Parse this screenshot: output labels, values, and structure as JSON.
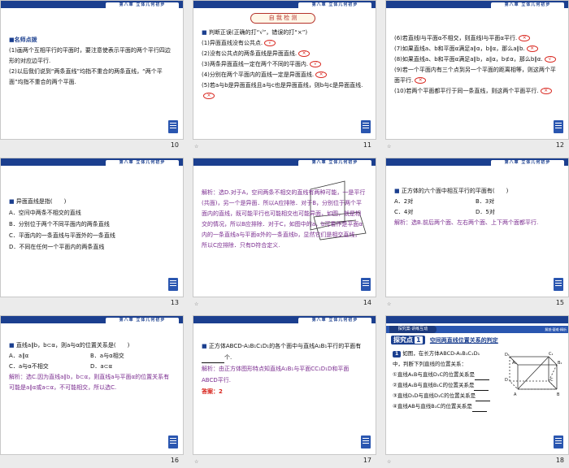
{
  "common": {
    "chapter_tab": "第八章 立体几何初步",
    "star": "☆"
  },
  "s10": {
    "num": "10",
    "heading": "■名师点拨",
    "p1": "(1)画两个互相平行的平面时，要注意使表示平面的两个平行四边形的对应边平行.",
    "p2": "(2)以后我们说到“两条直线”均指不重合的两条直线，“两个平面”均指不重合的两个平面."
  },
  "s11": {
    "num": "11",
    "title": "自 我 检 测",
    "intro": "判断正误(正确的打“√”，错误的打“×”)",
    "items": [
      {
        "text": "(1)异面直线没有公共点.",
        "mark": "√"
      },
      {
        "text": "(2)没有公共点的两条直线是异面直线.",
        "mark": "×"
      },
      {
        "text": "(3)两条异面直线一定在两个不同的平面内.",
        "mark": "√"
      },
      {
        "text": "(4)分别在两个平面内的直线一定是异面直线.",
        "mark": "×"
      },
      {
        "text": "(5)若a与b是异面直线且a与c也是异面直线，则b与c是异面直线.",
        "mark": "×"
      }
    ]
  },
  "s12": {
    "num": "12",
    "items": [
      {
        "text": "(6)若直线l与平面α不相交，则直线l与平面α平行.",
        "mark": "×"
      },
      {
        "text": "(7)如果直线a、b和平面α满足a∥α，b∥α，那么a∥b.",
        "mark": "×"
      },
      {
        "text": "(8)如果直线a、b和平面α满足a∥b，a∥α，b⊄α，那么b∥α.",
        "mark": "√"
      },
      {
        "text": "(9)若一个平面内有三个点到另一个平面的距离相等，则这两个平面平行.",
        "mark": "×"
      },
      {
        "text": "(10)若两个平面都平行于同一条直线，则这两个平面平行.",
        "mark": "×"
      }
    ]
  },
  "s13": {
    "num": "13",
    "question": "异面直线是指(　　)",
    "options": [
      "A．空间中两条不相交的直线",
      "B．分别位于两个不同平面内的两条直线",
      "C．平面内的一条直线与平面外的一条直线",
      "D．不同在任何一个平面内的两条直线"
    ]
  },
  "s14": {
    "num": "14",
    "text": "解析：选D.对于A，空间两条不相交的直线有两种可能，一是平行(共面)，另一个是异面．所以A应排除．对于B，分别位于两个平面内的直线，既可能平行也可能相交也可能异面，如图，就是相交的情况，所以B应排除．对于C，如图中的a，b可看作是平面α内的一条直线a与平面α外的一条直线b，显然它们是相交直线，所以C应排除．只有D符合定义."
  },
  "s15": {
    "num": "15",
    "question": "正方体的六个面中相互平行的平面有(　　)",
    "options": [
      "A．2对",
      "B．3对",
      "C．4对",
      "D．5对"
    ],
    "analysis": "解析：选B.前后两个面、左右两个面、上下两个面都平行."
  },
  "s16": {
    "num": "16",
    "question": "直线a∥b，b⊂α，则a与α的位置关系是(　　)",
    "options": [
      "A．a∥α",
      "B．a与α相交",
      "C．a与α不相交",
      "D．a⊂α"
    ],
    "analysis": "解析：选C.因为直线a∥b，b⊂α，则直线a与平面α的位置关系有可能是a∥α或a⊂α，不可能相交，所以选C."
  },
  "s17": {
    "num": "17",
    "question": "正方体ABCD-A₁B₁C₁D₁的各个面中与直线A₁B₁平行的平面有",
    "question_tail": "个.",
    "analysis": "解析：由正方体图形特点知直线A₁B₁与平面CC₁D₁D和平面ABCD平行.",
    "answer": "答案：2"
  },
  "s18": {
    "num": "18",
    "banner_label": "探究案·讲练互动",
    "banner_right": "解惑·疑难·精析",
    "point_label": "探究点",
    "point_num": "1",
    "point_title": "空间两直线位置关系的判定",
    "example_num": "1",
    "intro_a": "如图，在长方体ABCD-A₁B₁C₁D₁",
    "intro_b": "中，判断下列直线的位置关系：",
    "items": [
      "①直线A₁B与直线D₁C的位置关系是",
      "②直线A₁B与直线B₁C的位置关系是",
      "③直线D₁D与直线D₁C的位置关系是",
      "④直线AB与直线B₁C的位置关系是"
    ],
    "labels": [
      "D₁",
      "C₁",
      "A₁",
      "B₁",
      "D",
      "C",
      "A",
      "B"
    ]
  }
}
